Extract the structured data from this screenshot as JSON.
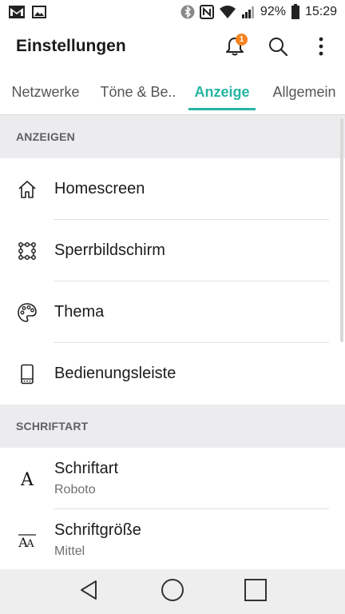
{
  "status_bar": {
    "battery_percent": "92%",
    "time": "15:29",
    "left_icons": [
      "gmail-notification-icon",
      "image-notification-icon"
    ],
    "right_icons": [
      "bluetooth-icon",
      "nfc-icon",
      "wifi-icon",
      "signal-icon",
      "battery-icon"
    ]
  },
  "app_bar": {
    "title": "Einstellungen",
    "notification_count": "1",
    "actions": [
      "notification-bell-icon",
      "search-icon",
      "more-vert-icon"
    ],
    "colors": {
      "badge": "#f5821f"
    }
  },
  "tabs": [
    {
      "label": "Netzwerke",
      "active": false
    },
    {
      "label": "Töne & Be..",
      "active": false
    },
    {
      "label": "Anzeige",
      "active": true
    },
    {
      "label": "Allgemein",
      "active": false
    }
  ],
  "accent_color": "#26b5a3",
  "sections": [
    {
      "header": "ANZEIGEN",
      "items": [
        {
          "label": "Homescreen",
          "icon": "home-icon"
        },
        {
          "label": "Sperrbildschirm",
          "icon": "lock-screen-icon"
        },
        {
          "label": "Thema",
          "icon": "palette-icon"
        },
        {
          "label": "Bedienungsleiste",
          "icon": "navigation-bar-icon"
        }
      ]
    },
    {
      "header": "SCHRIFTART",
      "items": [
        {
          "label": "Schriftart",
          "sub": "Roboto",
          "icon": "font-icon"
        },
        {
          "label": "Schriftgröße",
          "sub": "Mittel",
          "icon": "font-size-icon"
        }
      ]
    }
  ],
  "nav_bar": {
    "buttons": [
      "back-icon",
      "home-circle-icon",
      "recents-icon"
    ]
  }
}
